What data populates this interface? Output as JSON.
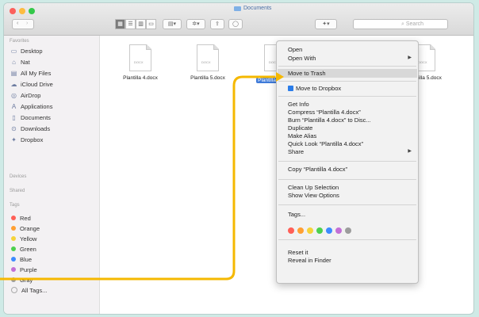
{
  "window": {
    "title": "Documents"
  },
  "toolbar": {
    "search_placeholder": "Search"
  },
  "sidebar": {
    "favorites_header": "Favorites",
    "favorites": [
      {
        "label": "Desktop",
        "icon": "desktop-icon"
      },
      {
        "label": "Nat",
        "icon": "home-icon"
      },
      {
        "label": "All My Files",
        "icon": "all-files-icon"
      },
      {
        "label": "iCloud Drive",
        "icon": "cloud-icon"
      },
      {
        "label": "AirDrop",
        "icon": "airdrop-icon"
      },
      {
        "label": "Applications",
        "icon": "applications-icon"
      },
      {
        "label": "Documents",
        "icon": "documents-icon"
      },
      {
        "label": "Downloads",
        "icon": "downloads-icon"
      },
      {
        "label": "Dropbox",
        "icon": "dropbox-icon"
      }
    ],
    "devices_header": "Devices",
    "shared_header": "Shared",
    "tags_header": "Tags",
    "tags": [
      {
        "label": "Red",
        "color": "#ff5f57"
      },
      {
        "label": "Orange",
        "color": "#ffa033"
      },
      {
        "label": "Yellow",
        "color": "#f5d33a"
      },
      {
        "label": "Green",
        "color": "#4cd04f"
      },
      {
        "label": "Blue",
        "color": "#3d8bff"
      },
      {
        "label": "Purple",
        "color": "#c36fd6"
      },
      {
        "label": "Gray",
        "color": "#9c9c9c"
      },
      {
        "label": "All Tags...",
        "color": ""
      }
    ]
  },
  "files": [
    {
      "name": "Plantilla 4.docx"
    },
    {
      "name": "Plantilla 5.docx"
    },
    {
      "name": "Plantilla 4.docx",
      "selected": true
    },
    {
      "name": "Plantilla 5.docx"
    }
  ],
  "context_menu": {
    "open": "Open",
    "open_with": "Open With",
    "move_to_trash": "Move to Trash",
    "move_to_dropbox": "Move to Dropbox",
    "get_info": "Get Info",
    "compress": "Compress “Plantilla 4.docx”",
    "burn": "Burn “Plantilla 4.docx” to Disc...",
    "duplicate": "Duplicate",
    "make_alias": "Make Alias",
    "quick_look": "Quick Look “Plantilla 4.docx”",
    "share": "Share",
    "copy": "Copy “Plantilla 4.docx”",
    "clean_up": "Clean Up Selection",
    "show_view_options": "Show View Options",
    "tags": "Tags...",
    "tag_colors": [
      "#ff5f57",
      "#ffa033",
      "#f5d33a",
      "#4cd04f",
      "#3d8bff",
      "#c36fd6",
      "#9c9c9c"
    ],
    "reveal_in_finder": "Reveal in Finder"
  },
  "annotation": {
    "color": "#f5b800"
  }
}
